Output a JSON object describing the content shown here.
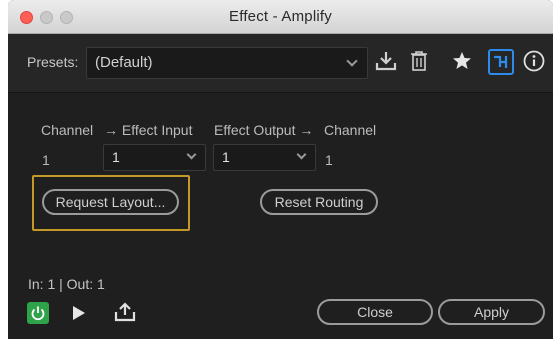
{
  "window": {
    "title": "Effect - Amplify"
  },
  "toolbar": {
    "presets_label": "Presets:",
    "presets_value": "(Default)",
    "icons": [
      "download-preset-icon",
      "trash-icon",
      "star-icon",
      "routing-icon",
      "info-icon"
    ]
  },
  "routing": {
    "headers": {
      "channel_in": "Channel",
      "effect_input": "→ Effect Input",
      "effect_output": "Effect Output →",
      "channel_out": "Channel"
    },
    "channel_in_value": "1",
    "effect_input_value": "1",
    "effect_output_value": "1",
    "channel_out_value": "1",
    "request_layout_label": "Request Layout...",
    "reset_routing_label": "Reset Routing"
  },
  "footer": {
    "io_status": "In: 1 | Out: 1",
    "close_label": "Close",
    "apply_label": "Apply"
  },
  "colors": {
    "highlight": "#c39a27",
    "power_on": "#2fa34a",
    "accent_blue": "#2d8ceb",
    "close_dot": "#fe5f57"
  }
}
